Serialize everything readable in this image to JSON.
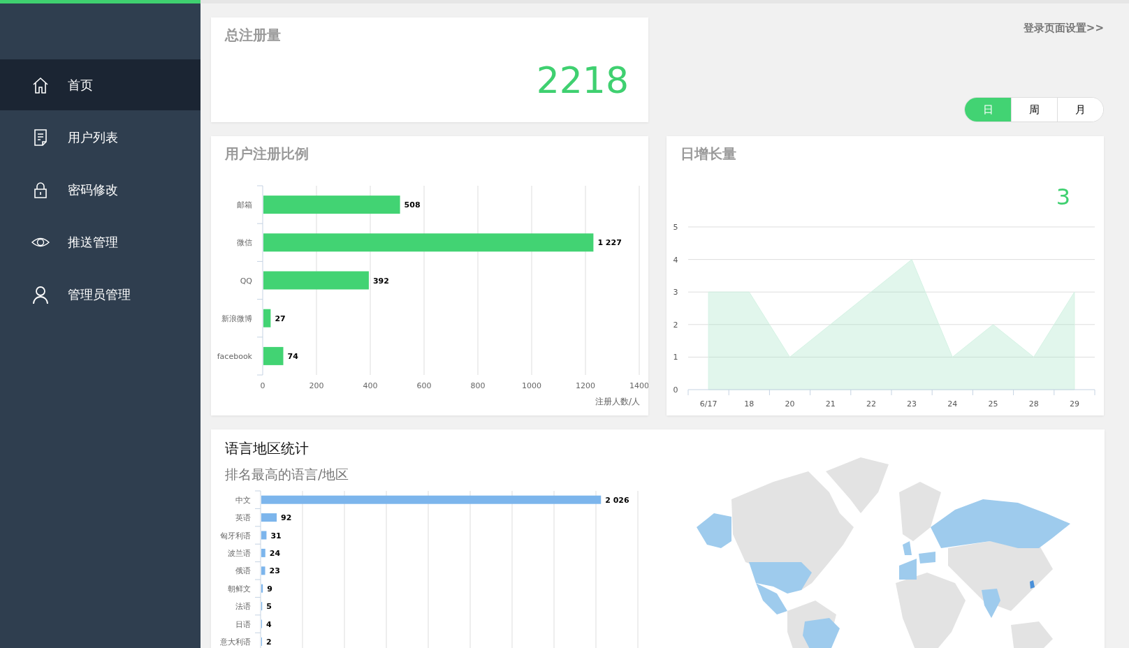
{
  "sidebar": {
    "items": [
      {
        "label": "首页",
        "kind": "home",
        "selected": true
      },
      {
        "label": "用户列表",
        "kind": "document",
        "selected": false
      },
      {
        "label": "密码修改",
        "kind": "lock",
        "selected": false
      },
      {
        "label": "推送管理",
        "kind": "eye",
        "selected": false
      },
      {
        "label": "管理员管理",
        "kind": "person",
        "selected": false
      }
    ]
  },
  "total_card": {
    "title": "总注册量",
    "value": "2218"
  },
  "settings_link": "登录页面设置>>",
  "period_toggle": [
    {
      "label": "日",
      "selected": true
    },
    {
      "label": "周",
      "selected": false
    },
    {
      "label": "月",
      "selected": false
    }
  ],
  "registration_card": {
    "title": "用户注册比例",
    "chart_data": {
      "type": "bar",
      "orientation": "horizontal",
      "categories": [
        "邮箱",
        "微信",
        "QQ",
        "新浪微博",
        "facebook"
      ],
      "values": [
        508,
        1227,
        392,
        27,
        74
      ],
      "xlim": [
        0,
        1400
      ],
      "xticks": [
        0,
        200,
        400,
        600,
        800,
        1000,
        1200,
        1400
      ],
      "xlabel": "注册人数/人",
      "grid": true,
      "value_labels": [
        "508",
        "1 227",
        "392",
        "27",
        "74"
      ]
    }
  },
  "daily_card": {
    "title": "日增长量",
    "current_value": "3",
    "chart_data": {
      "type": "area",
      "categories": [
        "6/17",
        "18",
        "20",
        "21",
        "22",
        "23",
        "24",
        "25",
        "28",
        "29"
      ],
      "values": [
        3,
        3,
        1,
        2,
        3,
        4,
        1,
        2,
        1,
        3
      ],
      "ylim": [
        0,
        5
      ],
      "yticks": [
        0,
        1,
        2,
        3,
        4,
        5
      ],
      "grid": true
    }
  },
  "language_card": {
    "title": "语言地区统计",
    "subtitle": "排名最高的语言/地区",
    "chart_data": {
      "type": "bar",
      "orientation": "horizontal",
      "categories": [
        "中文",
        "英语",
        "匈牙利语",
        "波兰语",
        "俄语",
        "朝鲜文",
        "法语",
        "日语",
        "意大利语"
      ],
      "values": [
        2026,
        92,
        31,
        24,
        23,
        9,
        5,
        4,
        2
      ],
      "xlim": [
        0,
        2250
      ],
      "grid": true,
      "value_labels": [
        "2 026",
        "92",
        "31",
        "24",
        "23",
        "9",
        "5",
        "4",
        "2"
      ]
    }
  }
}
